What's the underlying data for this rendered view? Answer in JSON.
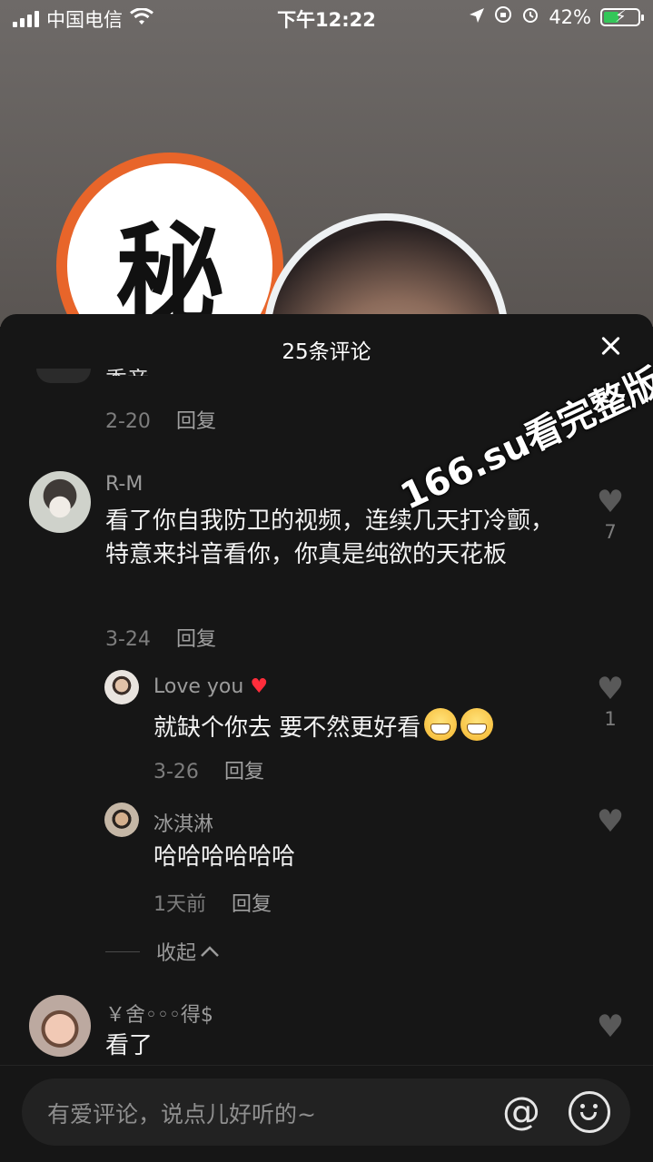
{
  "status_bar": {
    "carrier": "中国电信",
    "time": "下午12:22",
    "battery": "42%"
  },
  "video": {
    "badge_char": "秘"
  },
  "sheet": {
    "title": "25条评论",
    "close_label": "✕"
  },
  "comments": [
    {
      "cut_text": "秀音",
      "date": "2-20",
      "reply_label": "回复"
    },
    {
      "username": "R-M",
      "text": "看了你自我防卫的视频，连续几天打冷颤，特意来抖音看你，你真是纯欲的天花板",
      "date": "3-24",
      "reply_label": "回复",
      "likes": "7"
    },
    {
      "username": "Love you",
      "text": "就缺个你去 要不然更好看",
      "date": "3-26",
      "reply_label": "回复",
      "likes": "1"
    },
    {
      "username": "冰淇淋",
      "text": "哈哈哈哈哈哈",
      "date": "1天前",
      "reply_label": "回复"
    },
    {
      "username": "￥舍◦◦◦得$",
      "text": "看了"
    }
  ],
  "collapse_label": "收起",
  "watermark": "166.su看完整版",
  "input": {
    "placeholder": "有爱评论，说点儿好听的~"
  },
  "icons": {
    "heart": "♥",
    "at": "@"
  }
}
